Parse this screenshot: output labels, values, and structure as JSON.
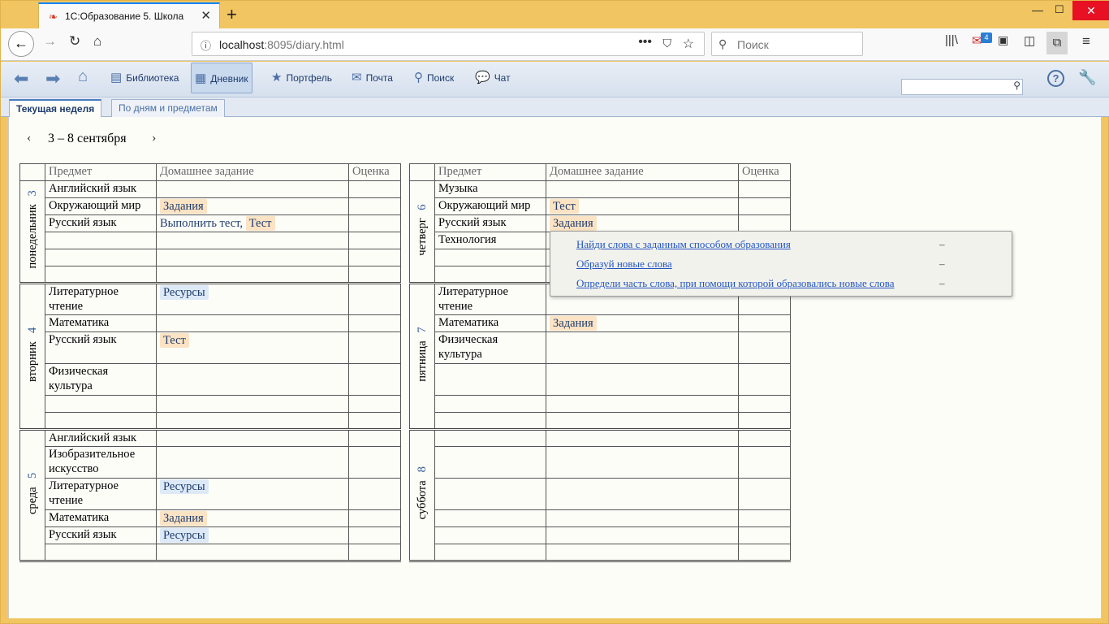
{
  "browser": {
    "tab_title": "1С:Образование 5. Школа",
    "url_host": "localhost",
    "url_rest": ":8095/diary.html",
    "search_placeholder": "Поиск",
    "mail_badge": "4"
  },
  "toolbar": {
    "items": [
      {
        "label": "Библиотека",
        "icon": "book-icon"
      },
      {
        "label": "Дневник",
        "icon": "diary-icon"
      },
      {
        "label": "Портфель",
        "icon": "star-icon"
      },
      {
        "label": "Почта",
        "icon": "mail-icon"
      },
      {
        "label": "Поиск",
        "icon": "search-icon"
      },
      {
        "label": "Чат",
        "icon": "chat-icon"
      }
    ]
  },
  "tabs": [
    "Текущая неделя",
    "По дням и предметам"
  ],
  "week": "3 – 8 сентября",
  "headers": {
    "subject": "Предмет",
    "homework": "Домашнее задание",
    "grade": "Оценка"
  },
  "days": {
    "mon": {
      "name": "понедельник",
      "num": "3",
      "rows": [
        {
          "s": "Английский язык"
        },
        {
          "s": "Окружающий мир",
          "tag": "Задания"
        },
        {
          "s": "Русский язык",
          "link": "Выполнить тест,",
          "tag": "Тест"
        }
      ]
    },
    "tue": {
      "name": "вторник",
      "num": "4",
      "rows": [
        {
          "s": "Литературное чтение",
          "res": "Ресурсы"
        },
        {
          "s": "Математика"
        },
        {
          "s": "Русский язык",
          "tag": "Тест"
        },
        {
          "s": "Физическая культура"
        }
      ]
    },
    "wed": {
      "name": "среда",
      "num": "5",
      "rows": [
        {
          "s": "Английский язык"
        },
        {
          "s": "Изобразительное искусство"
        },
        {
          "s": "Литературное чтение",
          "res": "Ресурсы"
        },
        {
          "s": "Математика",
          "tag": "Задания"
        },
        {
          "s": "Русский язык",
          "res": "Ресурсы"
        }
      ]
    },
    "thu": {
      "name": "четверг",
      "num": "6",
      "rows": [
        {
          "s": "Музыка"
        },
        {
          "s": "Окружающий мир",
          "tag": "Тест"
        },
        {
          "s": "Русский язык",
          "tag": "Задания"
        },
        {
          "s": "Технология"
        }
      ]
    },
    "fri": {
      "name": "пятница",
      "num": "7",
      "rows": [
        {
          "s": "Литературное чтение"
        },
        {
          "s": "Математика",
          "tag": "Задания"
        },
        {
          "s": "Физическая культура"
        }
      ]
    },
    "sat": {
      "name": "суббота",
      "num": "8",
      "rows": []
    }
  },
  "popup": [
    {
      "label": "Найди слова с заданным способом образования",
      "value": "–"
    },
    {
      "label": "Образуй новые слова",
      "value": "–"
    },
    {
      "label": "Определи часть слова, при помощи которой образовались новые слова",
      "value": "–"
    }
  ]
}
